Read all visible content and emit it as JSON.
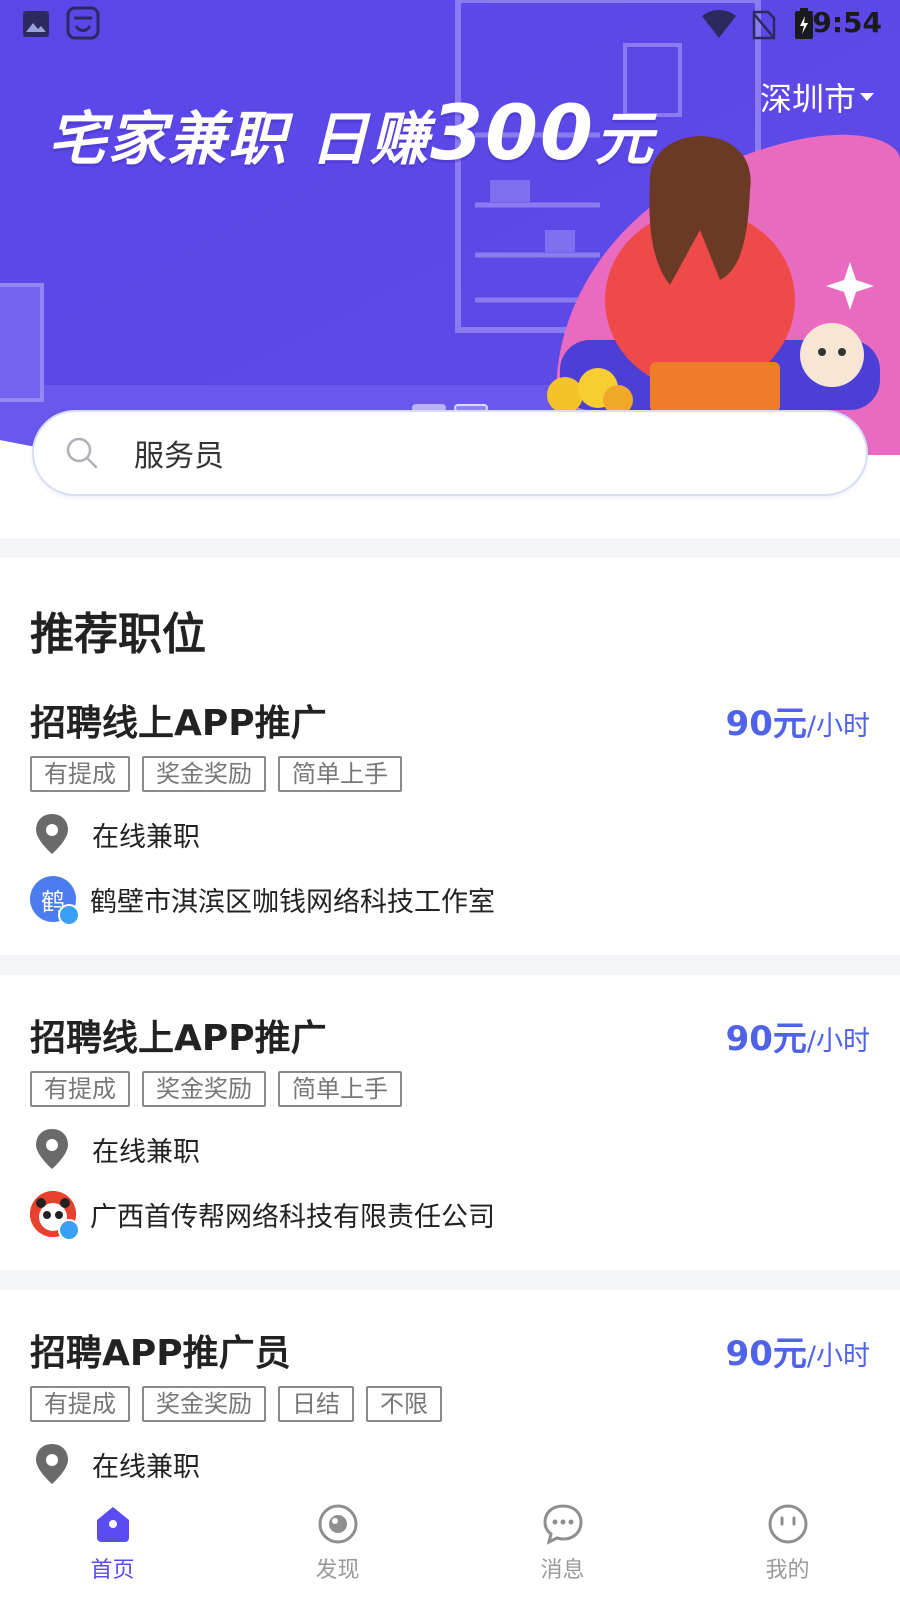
{
  "status_bar": {
    "time": "9:54"
  },
  "banner": {
    "city": "深圳市",
    "slogan_prefix": "宅家兼职  日赚",
    "slogan_number": "300",
    "slogan_suffix": "元"
  },
  "search": {
    "value": "服务员"
  },
  "section": {
    "title": "推荐职位"
  },
  "jobs": [
    {
      "title": "招聘线上APP推广",
      "salary_amount": "90元",
      "salary_unit": "/小时",
      "tags": [
        "有提成",
        "奖金奖励",
        "简单上手"
      ],
      "location": "在线兼职",
      "company": "鹤壁市淇滨区咖钱网络科技工作室",
      "company_avatar_char": "鹤"
    },
    {
      "title": "招聘线上APP推广",
      "salary_amount": "90元",
      "salary_unit": "/小时",
      "tags": [
        "有提成",
        "奖金奖励",
        "简单上手"
      ],
      "location": "在线兼职",
      "company": "广西首传帮网络科技有限责任公司",
      "company_avatar_char": ""
    },
    {
      "title": "招聘APP推广员",
      "salary_amount": "90元",
      "salary_unit": "/小时",
      "tags": [
        "有提成",
        "奖金奖励",
        "日结",
        "不限"
      ],
      "location": "在线兼职"
    }
  ],
  "bottom_nav": [
    {
      "label": "首页",
      "icon": "home-icon",
      "active": true
    },
    {
      "label": "发现",
      "icon": "discover-icon",
      "active": false
    },
    {
      "label": "消息",
      "icon": "message-icon",
      "active": false
    },
    {
      "label": "我的",
      "icon": "profile-icon",
      "active": false
    }
  ],
  "colors": {
    "brand": "#5a4cf0",
    "salary": "#4f63e8",
    "banner_bg": "#5b47e8"
  }
}
